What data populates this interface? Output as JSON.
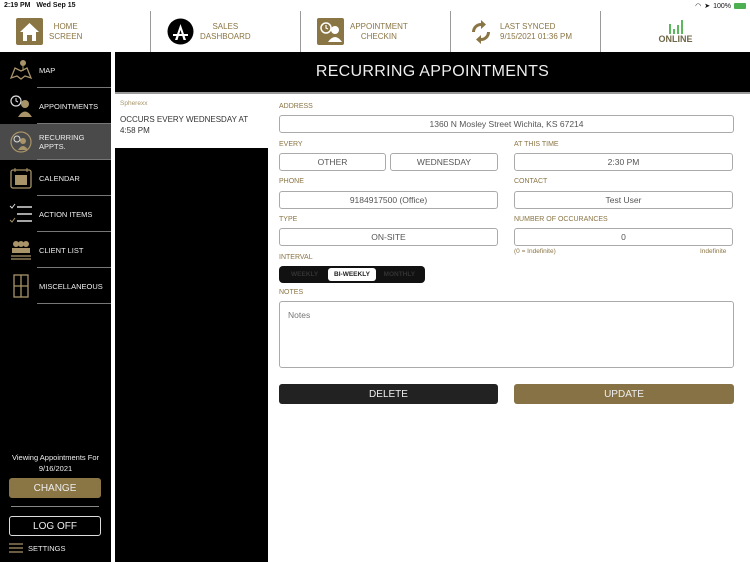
{
  "status_bar": {
    "time": "2:19 PM",
    "date": "Wed Sep 15",
    "battery": "100%"
  },
  "top_nav": {
    "home": {
      "line1": "HOME",
      "line2": "SCREEN"
    },
    "sales": {
      "line1": "SALES",
      "line2": "DASHBOARD"
    },
    "checkin": {
      "line1": "APPOINTMENT",
      "line2": "CHECKIN"
    },
    "sync": {
      "line1": "LAST SYNCED",
      "line2": "9/15/2021 01:36 PM"
    },
    "online": {
      "label": "ONLINE"
    }
  },
  "sidebar": {
    "items": [
      {
        "label": "MAP"
      },
      {
        "label": "APPOINTMENTS"
      },
      {
        "label": "RECURRING APPTS."
      },
      {
        "label": "CALENDAR"
      },
      {
        "label": "ACTION ITEMS"
      },
      {
        "label": "CLIENT LIST"
      },
      {
        "label": "MISCELLANEOUS"
      }
    ],
    "viewing_label": "Viewing Appointments For",
    "viewing_date": "9/16/2021",
    "change_label": "CHANGE",
    "logoff_label": "LOG OFF",
    "settings_label": "SETTINGS"
  },
  "header": {
    "title": "RECURRING APPOINTMENTS"
  },
  "list": {
    "items": [
      {
        "company": "Spherexx",
        "description": "OCCURS EVERY WEDNESDAY AT 4:58 PM"
      }
    ]
  },
  "form": {
    "address_label": "ADDRESS",
    "address_value": "1360 N Mosley Street Wichita, KS 67214",
    "every_label": "EVERY",
    "every_frequency": "OTHER",
    "every_day": "WEDNESDAY",
    "time_label": "AT THIS TIME",
    "time_value": "2:30 PM",
    "phone_label": "PHONE",
    "phone_value": "9184917500 (Office)",
    "contact_label": "CONTACT",
    "contact_value": "Test User",
    "type_label": "TYPE",
    "type_value": "ON-SITE",
    "occurrences_label": "NUMBER OF OCCURANCES",
    "occurrences_value": "0",
    "occurrences_hint": "(0 = Indefinite)",
    "occurrences_status": "Indefinite",
    "interval_label": "INTERVAL",
    "interval_options": [
      "WEEKLY",
      "BI-WEEKLY",
      "MONTHLY"
    ],
    "interval_selected": "BI-WEEKLY",
    "notes_label": "NOTES",
    "notes_placeholder": "Notes",
    "delete_label": "DELETE",
    "update_label": "UPDATE"
  },
  "colors": {
    "accent": "#8a7544",
    "online_green": "#5cb85c",
    "dark": "#000000"
  }
}
